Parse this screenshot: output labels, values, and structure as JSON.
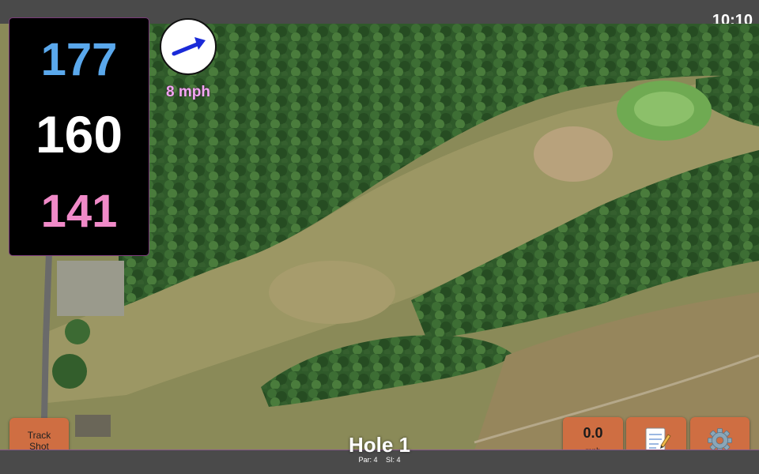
{
  "status_bar": {
    "time": "10:10"
  },
  "distances": {
    "back": "177",
    "middle": "160",
    "front": "141"
  },
  "wind": {
    "speed_text": "8 mph",
    "direction_icon": "wind-arrow-icon"
  },
  "hole": {
    "title": "Hole 1",
    "par": "Par: 4",
    "stroke_index": "SI: 4"
  },
  "buttons": {
    "track_shot": "Track\nShot",
    "speed_value": "0.0",
    "speed_unit": "mph",
    "notes_icon": "notepad-icon",
    "settings_icon": "gear-icon"
  },
  "colors": {
    "back_distance": "#5aa8ec",
    "middle_distance": "#ffffff",
    "front_distance": "#f08ac8",
    "wind_text": "#f3a7f3",
    "button_bg": "#cf6e42",
    "bar_bg": "#4a4a4a"
  }
}
